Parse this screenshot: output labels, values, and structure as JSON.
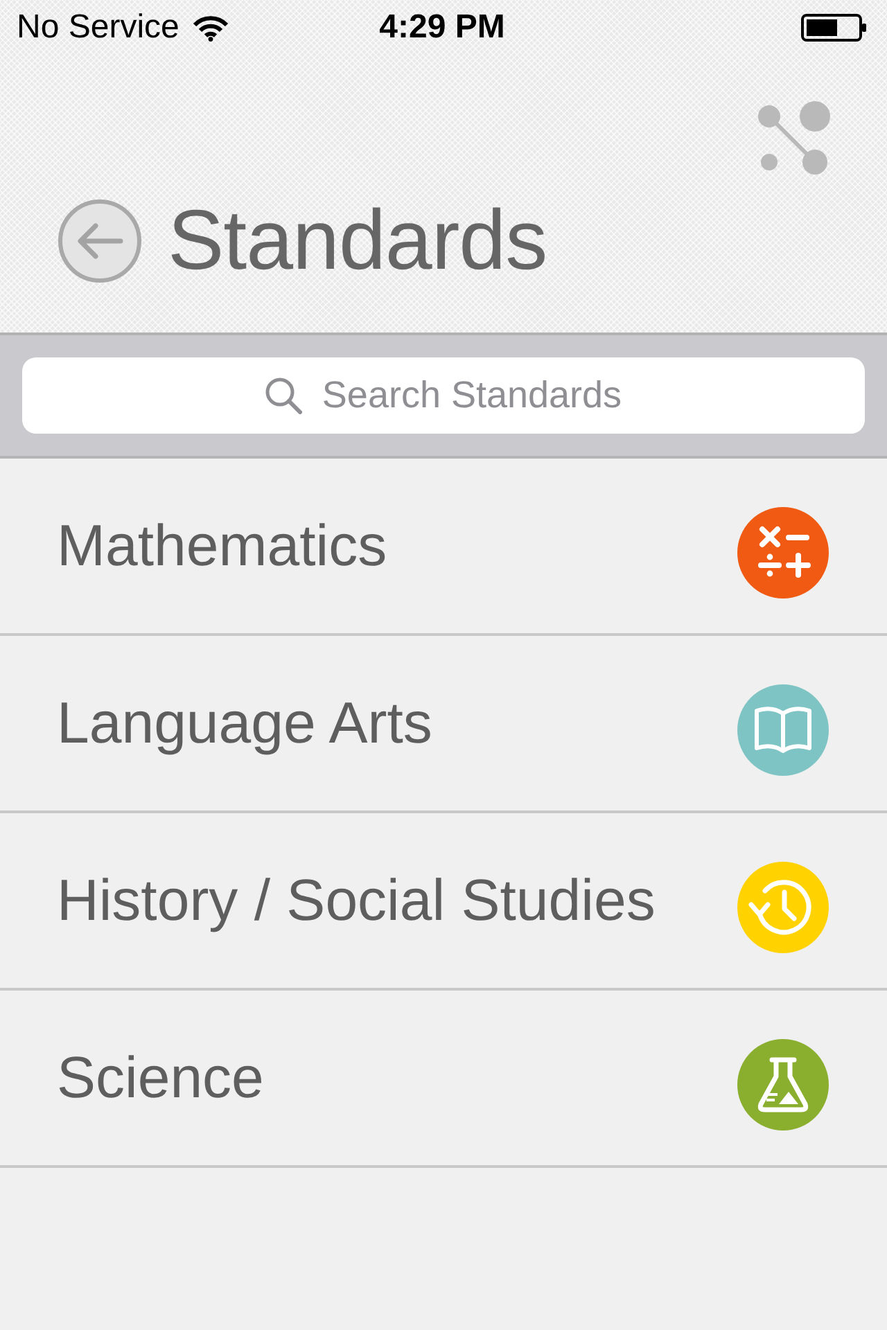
{
  "status_bar": {
    "carrier": "No Service",
    "time": "4:29 PM"
  },
  "header": {
    "title": "Standards"
  },
  "search": {
    "placeholder": "Search Standards"
  },
  "subjects": [
    {
      "label": "Mathematics",
      "kind": "math",
      "color": "#f05a12"
    },
    {
      "label": "Language Arts",
      "kind": "book",
      "color": "#7fc4c4"
    },
    {
      "label": "History / Social Studies",
      "kind": "history",
      "color": "#ffd200"
    },
    {
      "label": "Science",
      "kind": "flask",
      "color": "#8aae2e"
    }
  ]
}
